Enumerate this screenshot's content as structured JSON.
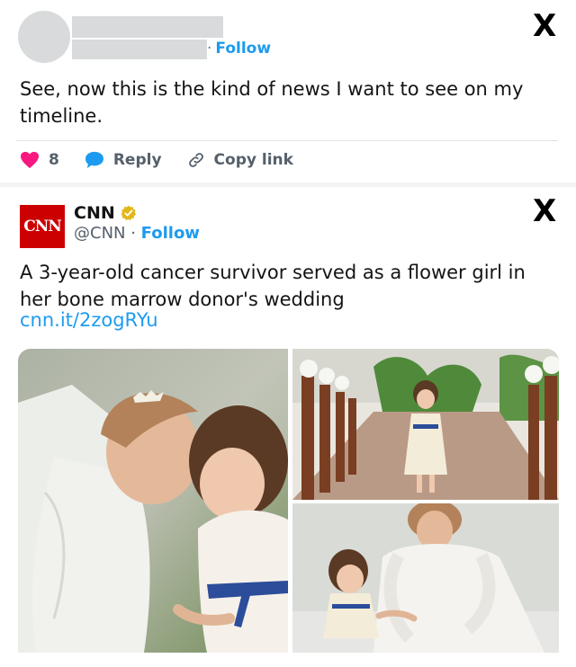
{
  "tweet1": {
    "follow_label": "Follow",
    "dot": "·",
    "text": "See, now this is the kind of news I want to see on my timeline.",
    "likes": "8",
    "reply_label": "Reply",
    "copy_link_label": "Copy link"
  },
  "tweet2": {
    "author_name": "CNN",
    "handle": "@CNN",
    "separator": " · ",
    "follow_label": "Follow",
    "logo_text": "CNN",
    "text": "A 3-year-old cancer survivor served as a flower girl in her bone marrow donor's wedding",
    "link_text": "cnn.it/2zogRYu"
  },
  "icons": {
    "x_logo": "X",
    "heart": "heart-icon",
    "reply": "speech-bubble-icon",
    "copy": "link-icon",
    "verified": "verified-badge-icon"
  },
  "colors": {
    "accent": "#1d9bf0",
    "like": "#f91880",
    "cnn_red": "#cc0000",
    "verified_gold": "#e2b719"
  }
}
